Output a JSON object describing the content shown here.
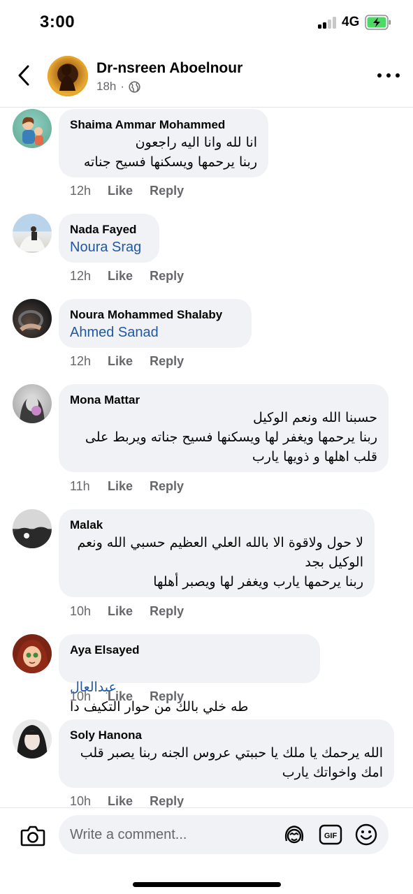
{
  "status_bar": {
    "time": "3:00",
    "network": "4G"
  },
  "header": {
    "name": "Dr-nsreen Aboelnour",
    "time": "18h",
    "dot": "·"
  },
  "comments": [
    {
      "name": "Shaima Ammar Mohammed",
      "text": "انا لله وانا اليه راجعون\nربنا يرحمها ويسكنها فسيح جناته",
      "mention": "",
      "time": "12h",
      "like": "Like",
      "reply": "Reply"
    },
    {
      "name": "Nada Fayed",
      "text": "",
      "mention": "Noura Srag",
      "time": "12h",
      "like": "Like",
      "reply": "Reply"
    },
    {
      "name": "Noura Mohammed Shalaby",
      "text": "",
      "mention": "Ahmed Sanad",
      "time": "12h",
      "like": "Like",
      "reply": "Reply"
    },
    {
      "name": "Mona Mattar",
      "text": "حسبنا الله ونعم الوكيل\nربنا يرحمها ويغفر لها ويسكنها فسيح جناته ويربط على\nقلب اهلها و ذويها يارب",
      "mention": "",
      "time": "11h",
      "like": "Like",
      "reply": "Reply"
    },
    {
      "name": "Malak",
      "text": "لا حول ولاقوة الا بالله العلي العظيم حسبي الله ونعم\nالوكيل بجد\nربنا يرحمها يارب ويغفر لها ويصبر أهلها",
      "mention": "",
      "time": "10h",
      "like": "Like",
      "reply": "Reply"
    },
    {
      "name": "Aya Elsayed",
      "text": "طه خلي بالك من حوار التكيف دا",
      "mention": "عبدالعال",
      "time": "10h",
      "like": "Like",
      "reply": "Reply"
    },
    {
      "name": "Soly Hanona",
      "text": "الله يرحمك يا ملك يا حببتي عروس الجنه ربنا يصبر قلب\nامك واخواتك يارب",
      "mention": "",
      "time": "10h",
      "like": "Like",
      "reply": "Reply"
    }
  ],
  "composer": {
    "placeholder": "Write a comment..."
  },
  "colors": {
    "link": "#2057a6",
    "bubble": "#f0f2f5",
    "muted": "#65676b",
    "battery": "#4cd964"
  },
  "icons": [
    "back-arrow-icon",
    "globe-icon",
    "more-icon",
    "camera-icon",
    "avatar-sticker-icon",
    "gif-icon",
    "emoji-icon"
  ]
}
